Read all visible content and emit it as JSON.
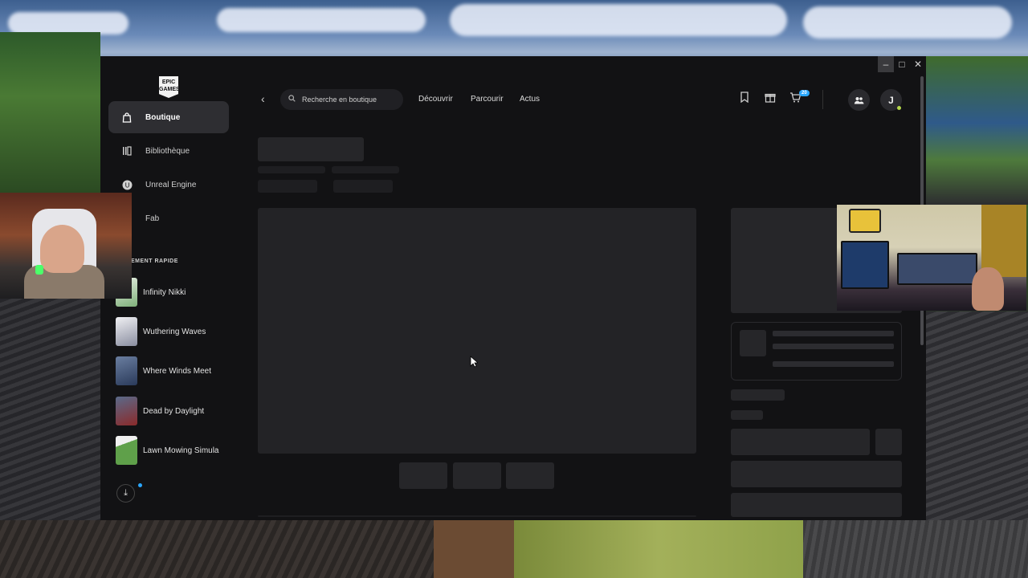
{
  "app": {
    "logo_text": "EPIC GAMES",
    "window_controls": {
      "minimize": "–",
      "maximize": "□",
      "close": "✕"
    }
  },
  "sidebar": {
    "items": [
      {
        "label": "Boutique",
        "icon": "bag-icon",
        "active": true
      },
      {
        "label": "Bibliothèque",
        "icon": "library-icon",
        "active": false
      },
      {
        "label": "Unreal Engine",
        "icon": "unreal-icon",
        "active": false
      },
      {
        "label": "Fab",
        "icon": "fab-icon",
        "active": false
      }
    ],
    "quick_launch_title": "EMENT RAPIDE",
    "games": [
      {
        "name": "Infinity Nikki"
      },
      {
        "name": "Wuthering Waves"
      },
      {
        "name": "Where Winds Meet"
      },
      {
        "name": "Dead by Daylight"
      },
      {
        "name": "Lawn Mowing Simula"
      }
    ]
  },
  "topbar": {
    "back": "‹",
    "search_placeholder": "Recherche en boutique",
    "nav": [
      "Découvrir",
      "Parcourir",
      "Actus"
    ],
    "cart_count": "20",
    "avatar_initial": "J"
  },
  "colors": {
    "window_bg": "#121214",
    "accent": "#2aa7ff",
    "skeleton": "#262629"
  }
}
